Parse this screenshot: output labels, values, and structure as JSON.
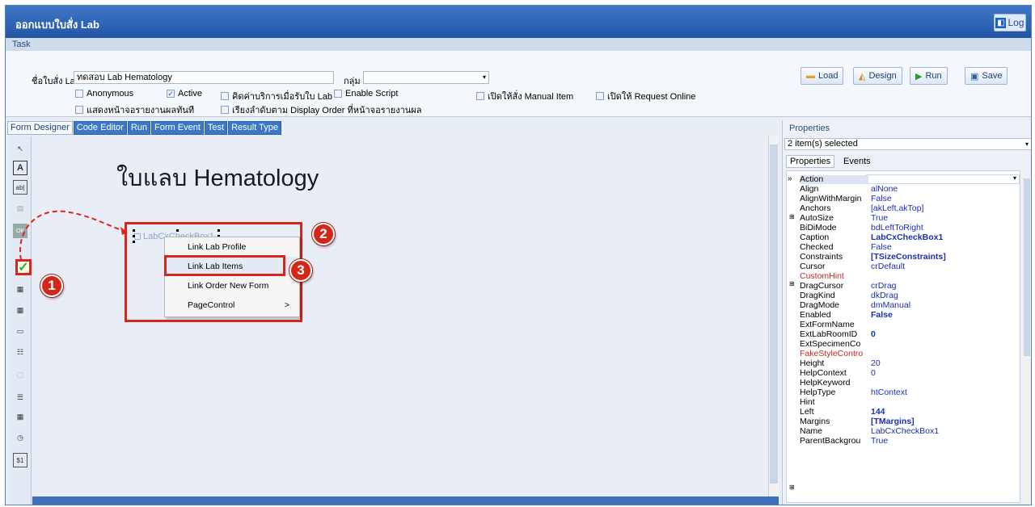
{
  "window": {
    "title": "ออกแบบใบสั่ง Lab",
    "log_button": "Log",
    "log_icon": "log-icon"
  },
  "menu_bar": {
    "task": "Task"
  },
  "form_params": {
    "name_label": "ชื่อใบสั่ง Lab",
    "name_value": "ทดสอบ Lab Hematology",
    "group_label": "กลุ่ม",
    "group_value": "",
    "checkboxes": [
      {
        "label": "Anonymous",
        "checked": false
      },
      {
        "label": "Active",
        "checked": true
      },
      {
        "label": "คิดค่าบริการเมื่อรับใบ Lab",
        "checked": false
      },
      {
        "label": "Enable Script",
        "checked": false
      },
      {
        "label": "เปิดให้สั่ง Manual Item",
        "checked": false
      },
      {
        "label": "เปิดให้ Request Online",
        "checked": false
      },
      {
        "label": "แสดงหน้าจอรายงานผลทันที",
        "checked": false
      },
      {
        "label": "เรียงลำดับตาม Display Order ที่หน้าจอรายงานผล",
        "checked": false
      }
    ]
  },
  "toolbar": {
    "load": "Load",
    "design": "Design",
    "run": "Run",
    "save": "Save"
  },
  "designer_tabs": [
    "Form Designer",
    "Code Editor",
    "Run",
    "Form Event",
    "Test",
    "Result Type"
  ],
  "canvas": {
    "heading": "ใบแลบ Hematology",
    "checkbox_caption": "LabCxCheckBox1"
  },
  "context_menu": {
    "items": [
      "Link Lab Profile",
      "Link Lab Items",
      "Link Order New Form",
      "PageControl"
    ],
    "submenu_arrow": ">"
  },
  "badges": [
    "1",
    "2",
    "3"
  ],
  "properties": {
    "title": "Properties",
    "selection": "2 item(s) selected",
    "tabs": [
      "Properties",
      "Events"
    ],
    "rows": [
      {
        "name": "Action",
        "value": ""
      },
      {
        "name": "Align",
        "value": "alNone"
      },
      {
        "name": "AlignWithMargin",
        "value": "False"
      },
      {
        "name": "Anchors",
        "value": "[akLeft,akTop]"
      },
      {
        "name": "AutoSize",
        "value": "True"
      },
      {
        "name": "BiDiMode",
        "value": "bdLeftToRight"
      },
      {
        "name": "Caption",
        "value": "LabCxCheckBox1"
      },
      {
        "name": "Checked",
        "value": "False"
      },
      {
        "name": "Constraints",
        "value": "[TSizeConstraints]"
      },
      {
        "name": "Cursor",
        "value": "crDefault"
      },
      {
        "name": "CustomHint",
        "value": ""
      },
      {
        "name": "DragCursor",
        "value": "crDrag"
      },
      {
        "name": "DragKind",
        "value": "dkDrag"
      },
      {
        "name": "DragMode",
        "value": "dmManual"
      },
      {
        "name": "Enabled",
        "value": "False"
      },
      {
        "name": "ExtFormName",
        "value": ""
      },
      {
        "name": "ExtLabRoomID",
        "value": "0"
      },
      {
        "name": "ExtSpecimenCo",
        "value": ""
      },
      {
        "name": "FakeStyleContro",
        "value": ""
      },
      {
        "name": "Height",
        "value": "20"
      },
      {
        "name": "HelpContext",
        "value": "0"
      },
      {
        "name": "HelpKeyword",
        "value": ""
      },
      {
        "name": "HelpType",
        "value": "htContext"
      },
      {
        "name": "Hint",
        "value": ""
      },
      {
        "name": "Left",
        "value": "144"
      },
      {
        "name": "Margins",
        "value": "[TMargins]"
      },
      {
        "name": "Name",
        "value": "LabCxCheckBox1"
      },
      {
        "name": "ParentBackgrou",
        "value": "True"
      }
    ]
  },
  "colors": {
    "accent": "#2455a5",
    "highlight_red": "#d9261c",
    "property_value": "#1a2fae"
  }
}
